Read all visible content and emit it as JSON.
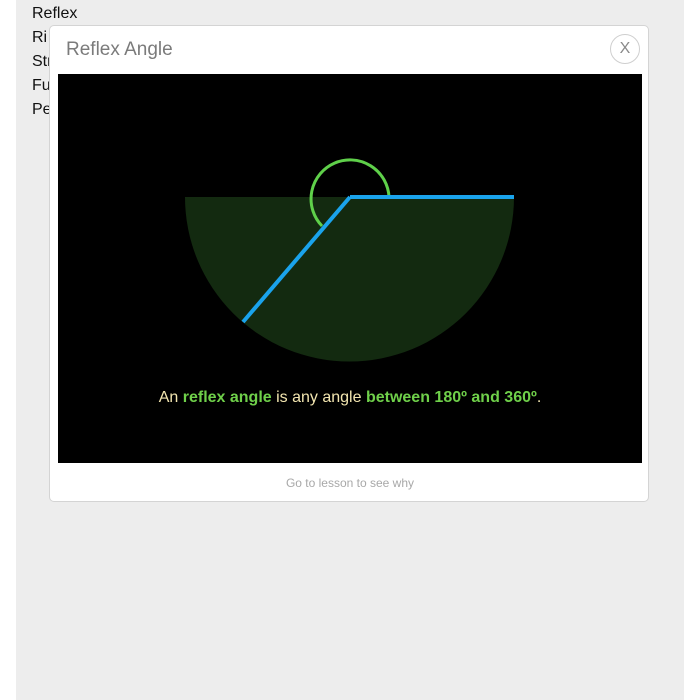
{
  "sidebar": {
    "items": [
      {
        "label": "Reflex"
      },
      {
        "label": "Ri"
      },
      {
        "label": "Str"
      },
      {
        "label": "Fu"
      },
      {
        "label": "Pe"
      }
    ]
  },
  "modal": {
    "title": "Reflex Angle",
    "close_label": "X",
    "caption": {
      "prefix": "An ",
      "term": "reflex angle",
      "middle": " is any angle ",
      "range": "between 180º and 360º",
      "suffix": "."
    },
    "link_label": "Go to lesson to see why"
  },
  "colors": {
    "arm": "#1aa3ec",
    "arc": "#5fd04a",
    "fill": "#132a10",
    "highlight": "#6fd04a",
    "caption_text": "#f3e6b0"
  }
}
